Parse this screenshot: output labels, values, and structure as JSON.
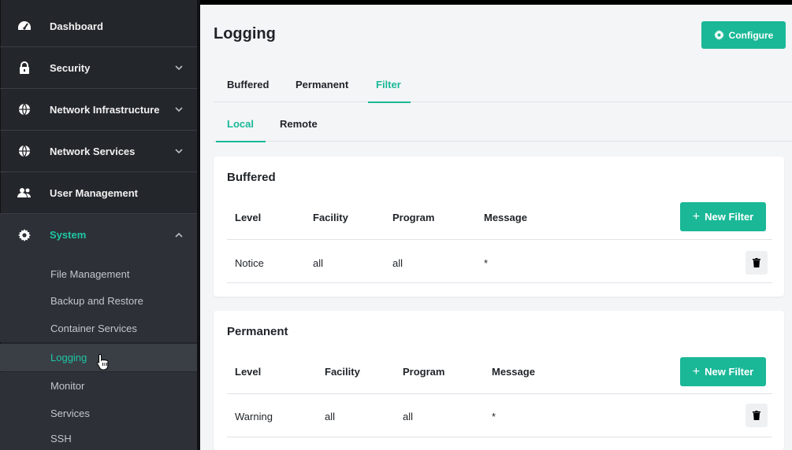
{
  "sidebar": {
    "items": [
      {
        "label": "Dashboard",
        "icon": "gauge-icon"
      },
      {
        "label": "Security",
        "icon": "lock-icon"
      },
      {
        "label": "Network Infrastructure",
        "icon": "globe-icon"
      },
      {
        "label": "Network Services",
        "icon": "globe-icon"
      },
      {
        "label": "User Management",
        "icon": "users-icon"
      },
      {
        "label": "System",
        "icon": "gear-icon"
      }
    ],
    "system_children": [
      "File Management",
      "Backup and Restore",
      "Container Services",
      "Logging",
      "Monitor",
      "Services",
      "SSH"
    ]
  },
  "header": {
    "title": "Logging",
    "configure_label": "Configure"
  },
  "tabs": [
    "Buffered",
    "Permanent",
    "Filter"
  ],
  "subtabs": [
    "Local",
    "Remote"
  ],
  "buffered": {
    "title": "Buffered",
    "columns": [
      "Level",
      "Facility",
      "Program",
      "Message"
    ],
    "new_filter_label": "New Filter",
    "rows": [
      [
        "Notice",
        "all",
        "all",
        "*"
      ]
    ]
  },
  "permanent": {
    "title": "Permanent",
    "columns": [
      "Level",
      "Facility",
      "Program",
      "Message"
    ],
    "new_filter_label": "New Filter",
    "rows": [
      [
        "Warning",
        "all",
        "all",
        "*"
      ]
    ]
  },
  "colors": {
    "accent": "#1ab897",
    "sidebar_bg": "#23262b",
    "active_text": "#1ec6a5"
  }
}
